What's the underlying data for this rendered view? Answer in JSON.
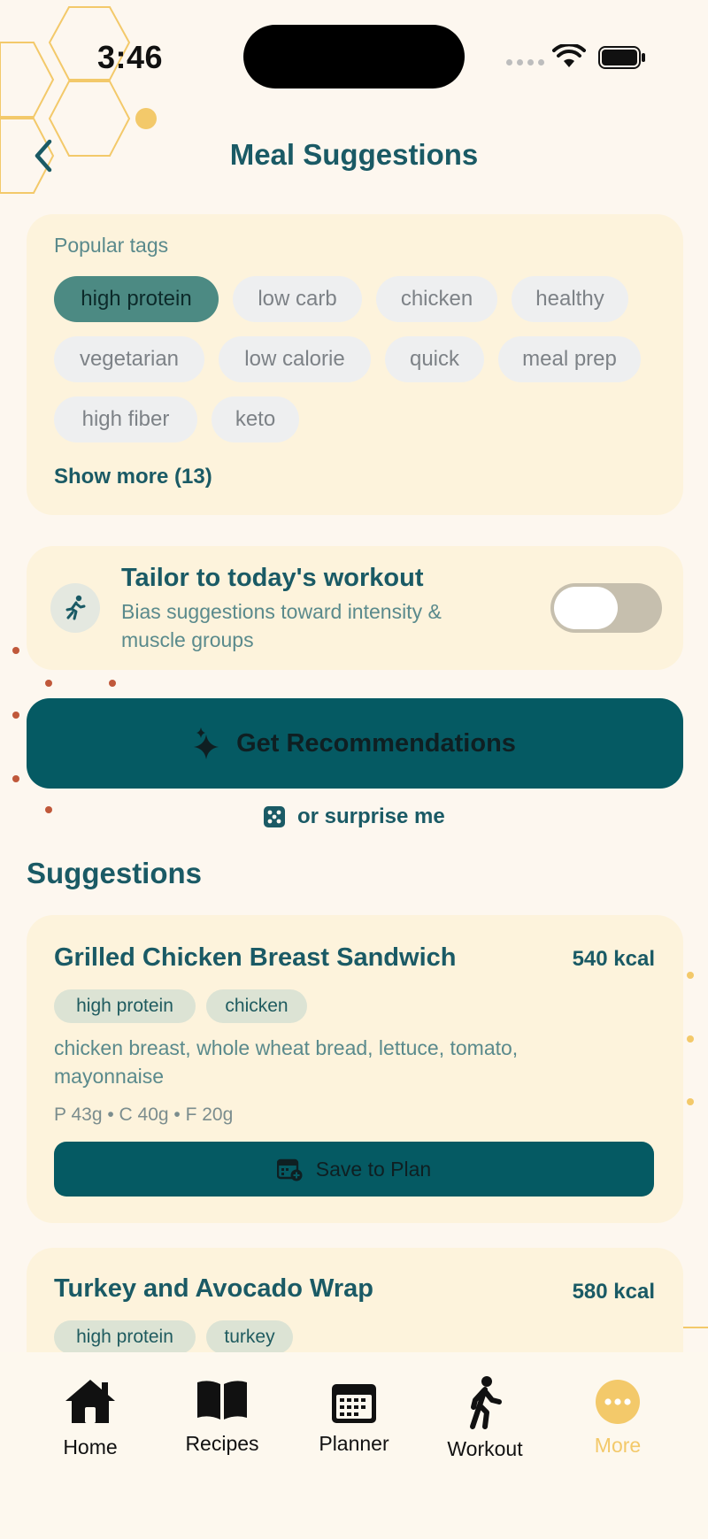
{
  "status_bar": {
    "time": "3:46"
  },
  "header": {
    "title": "Meal Suggestions"
  },
  "tags": {
    "label": "Popular tags",
    "items": [
      "high protein",
      "low carb",
      "chicken",
      "healthy",
      "vegetarian",
      "low calorie",
      "quick",
      "meal prep",
      "high fiber",
      "keto"
    ],
    "selected": "high protein",
    "show_more": "Show more (13)"
  },
  "tailor": {
    "title": "Tailor to today's workout",
    "description": "Bias suggestions toward intensity & muscle groups",
    "enabled": false
  },
  "actions": {
    "recommend_label": "Get Recommendations",
    "surprise_label": "or surprise me"
  },
  "suggestions": {
    "title": "Suggestions",
    "items": [
      {
        "name": "Grilled Chicken Breast Sandwich",
        "kcal": "540 kcal",
        "tags": [
          "high protein",
          "chicken"
        ],
        "ingredients": "chicken breast, whole wheat bread, lettuce, tomato, mayonnaise",
        "macros": "P 43g • C 40g • F 20g",
        "save_label": "Save to Plan"
      },
      {
        "name": "Turkey and Avocado Wrap",
        "kcal": "580 kcal",
        "tags": [
          "high protein",
          "turkey"
        ]
      }
    ]
  },
  "tabbar": {
    "items": [
      {
        "label": "Home",
        "icon": "home-icon"
      },
      {
        "label": "Recipes",
        "icon": "book-icon"
      },
      {
        "label": "Planner",
        "icon": "calendar-icon"
      },
      {
        "label": "Workout",
        "icon": "walking-icon"
      },
      {
        "label": "More",
        "icon": "more-icon"
      }
    ],
    "active": "More"
  },
  "colors": {
    "background": "#fdf7ef",
    "card": "#fdf3dc",
    "primary": "#055a63",
    "selected_chip": "#4c8a83",
    "accent": "#f3c96a",
    "decor_dots": "#c0583a"
  }
}
